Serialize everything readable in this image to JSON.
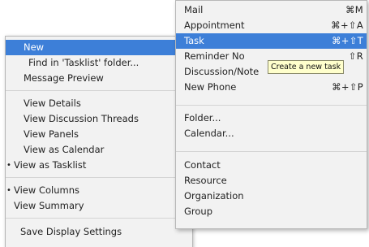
{
  "context_menu": {
    "items": [
      {
        "label": "New",
        "selected": true
      },
      {
        "label": "Find in 'Tasklist' folder..."
      },
      {
        "label": "Message Preview"
      },
      {
        "label": "View Details"
      },
      {
        "label": "View Discussion Threads"
      },
      {
        "label": "View Panels"
      },
      {
        "label": "View as Calendar"
      },
      {
        "label": "View as Tasklist",
        "checked": true,
        "bullet": "•"
      },
      {
        "label": "View Columns",
        "checked": true,
        "bullet": "•"
      },
      {
        "label": "View Summary"
      },
      {
        "label": "Save Display Settings"
      }
    ]
  },
  "new_submenu": {
    "items": [
      {
        "label": "Mail",
        "shortcut": "⌘M"
      },
      {
        "label": "Appointment",
        "shortcut": "⌘+⇧A"
      },
      {
        "label": "Task",
        "shortcut": "⌘+⇧T",
        "selected": true
      },
      {
        "label": "Reminder No",
        "shortcut": "⇧R"
      },
      {
        "label": "Discussion/Note"
      },
      {
        "label": "New Phone",
        "shortcut": "⌘+⇧P"
      },
      {
        "label": "Folder..."
      },
      {
        "label": "Calendar..."
      },
      {
        "label": "Contact"
      },
      {
        "label": "Resource"
      },
      {
        "label": "Organization"
      },
      {
        "label": "Group"
      }
    ]
  },
  "tooltip": {
    "text": "Create a new task"
  },
  "colors": {
    "selection": "#3d7fd8",
    "menu_background": "#f2f2f2",
    "tooltip_background": "#ffffcc"
  }
}
